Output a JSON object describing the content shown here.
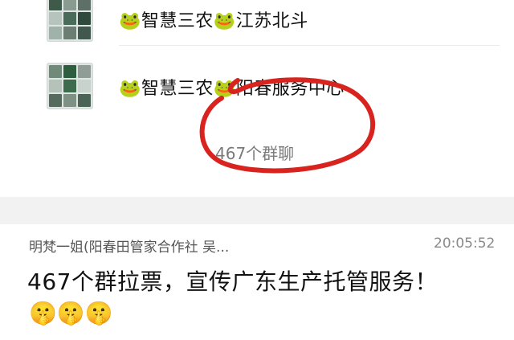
{
  "groups": {
    "items": [
      {
        "name": "🐸智慧三农🐸江苏北斗",
        "avatar_colors": [
          "#3d5a4a",
          "#8a9b92",
          "#5e6f66",
          "#b7c4bd",
          "#4a6b5a",
          "#2f4a3c",
          "#9fb3a8",
          "#6c7d74",
          "#41594c"
        ]
      },
      {
        "name": "🐸智慧三农🐸阳春服务中心",
        "avatar_colors": [
          "#6f8a78",
          "#2e5e3e",
          "#8f9d94",
          "#b4c2b9",
          "#3e6a4d",
          "#c9d3cd",
          "#556b5d",
          "#7f9185",
          "#4b6354"
        ]
      }
    ],
    "count_label": "467个群聊"
  },
  "chat": {
    "sender": "明梵一姐(阳春田管家合作社 吴...",
    "timestamp": "20:05:52",
    "message": "467个群拉票，宣传广东生产托管服务！",
    "emojis": "🤫🤫🤫"
  },
  "colors": {
    "annotation": "#d8231f",
    "background": "#ffffff",
    "separator": "#f2f2f2"
  }
}
